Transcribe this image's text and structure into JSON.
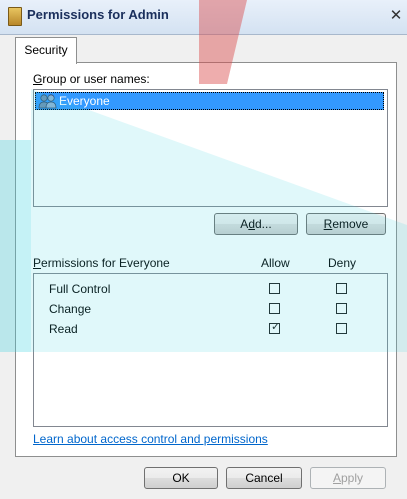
{
  "window": {
    "title": "Permissions for Admin",
    "close_glyph": "✕"
  },
  "tabs": [
    {
      "label": "Security",
      "active": true
    }
  ],
  "group_section": {
    "label_pre": "",
    "label_mnemonic": "G",
    "label_post": "roup or user names:",
    "items": [
      {
        "name": "Everyone",
        "selected": true,
        "icon": "users-icon"
      }
    ]
  },
  "buttons": {
    "add": {
      "pre": "A",
      "mnemonic": "d",
      "post": "d..."
    },
    "remove": {
      "pre": "",
      "mnemonic": "R",
      "post": "emove"
    },
    "ok": "OK",
    "cancel": "Cancel",
    "apply": {
      "pre": "",
      "mnemonic": "A",
      "post": "pply",
      "disabled": true
    }
  },
  "permissions": {
    "header_mnemonic": "P",
    "header_post": "ermissions for Everyone",
    "col_allow": "Allow",
    "col_deny": "Deny",
    "rows": [
      {
        "name": "Full Control",
        "allow": false,
        "deny": false
      },
      {
        "name": "Change",
        "allow": false,
        "deny": false
      },
      {
        "name": "Read",
        "allow": true,
        "deny": false
      }
    ]
  },
  "help_link": "Learn about access control and permissions",
  "colors": {
    "selection": "#3399ff",
    "link": "#0066cc",
    "watermark_cyan": "#3fd3e0",
    "watermark_red": "#d94a4a"
  }
}
